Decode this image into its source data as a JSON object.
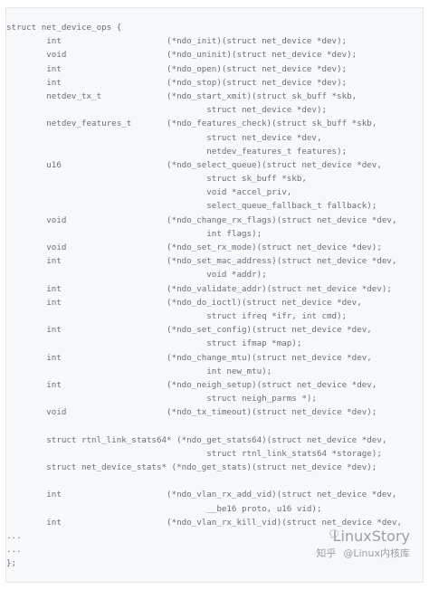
{
  "code": {
    "lines": [
      "struct net_device_ops {",
      "        int                     (*ndo_init)(struct net_device *dev);",
      "        void                    (*ndo_uninit)(struct net_device *dev);",
      "        int                     (*ndo_open)(struct net_device *dev);",
      "        int                     (*ndo_stop)(struct net_device *dev);",
      "        netdev_tx_t             (*ndo_start_xmit)(struct sk_buff *skb,",
      "                                        struct net_device *dev);",
      "        netdev_features_t       (*ndo_features_check)(struct sk_buff *skb,",
      "                                        struct net_device *dev,",
      "                                        netdev_features_t features);",
      "        u16                     (*ndo_select_queue)(struct net_device *dev,",
      "                                        struct sk_buff *skb,",
      "                                        void *accel_priv,",
      "                                        select_queue_fallback_t fallback);",
      "        void                    (*ndo_change_rx_flags)(struct net_device *dev,",
      "                                        int flags);",
      "        void                    (*ndo_set_rx_mode)(struct net_device *dev);",
      "        int                     (*ndo_set_mac_address)(struct net_device *dev,",
      "                                        void *addr);",
      "        int                     (*ndo_validate_addr)(struct net_device *dev);",
      "        int                     (*ndo_do_ioctl)(struct net_device *dev,",
      "                                        struct ifreq *ifr, int cmd);",
      "        int                     (*ndo_set_config)(struct net_device *dev,",
      "                                        struct ifmap *map);",
      "        int                     (*ndo_change_mtu)(struct net_device *dev,",
      "                                        int new_mtu);",
      "        int                     (*ndo_neigh_setup)(struct net_device *dev,",
      "                                        struct neigh_parms *);",
      "        void                    (*ndo_tx_timeout)(struct net_device *dev);",
      "",
      "        struct rtnl_link_stats64* (*ndo_get_stats64)(struct net_device *dev,",
      "                                        struct rtnl_link_stats64 *storage);",
      "        struct net_device_stats* (*ndo_get_stats)(struct net_device *dev);",
      "",
      "        int                     (*ndo_vlan_rx_add_vid)(struct net_device *dev,",
      "                                        __be16 proto, u16 vid);",
      "        int                     (*ndo_vlan_rx_kill_vid)(struct net_device *dev,",
      "...",
      "...",
      "};"
    ]
  },
  "watermark": {
    "top_text": "LinuxStory",
    "bottom_left": "知乎",
    "bottom_right": "@Linux内核库"
  }
}
